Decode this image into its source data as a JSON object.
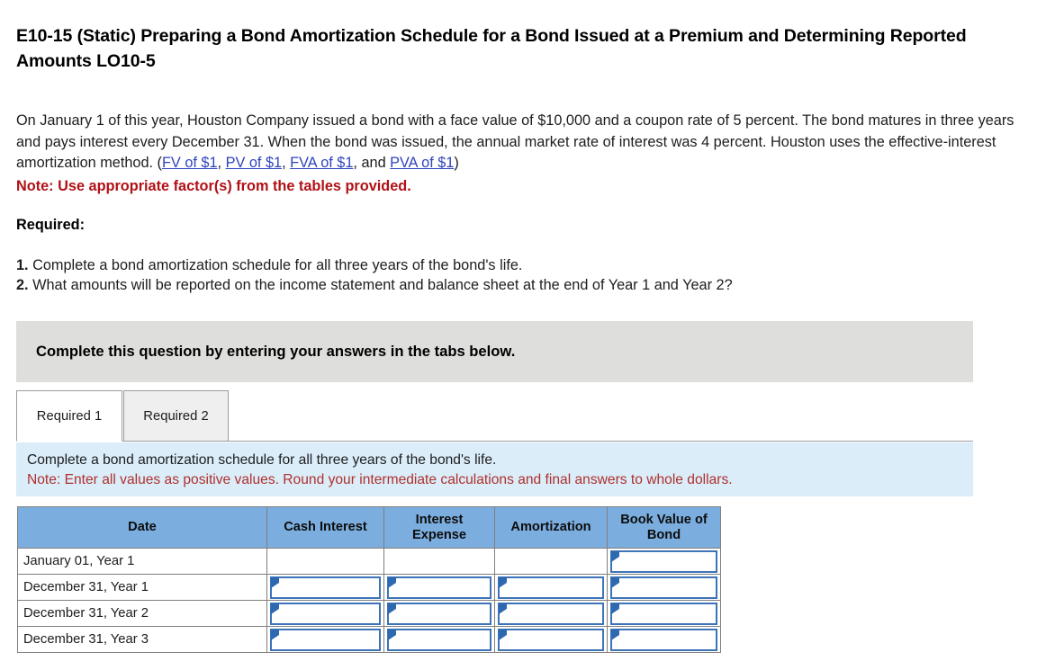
{
  "exercise": {
    "title": "E10-15 (Static) Preparing a Bond Amortization Schedule for a Bond Issued at a Premium and Determining Reported Amounts LO10-5",
    "body_part1": "On January 1 of this year, Houston Company issued a bond with a face value of $10,000 and a coupon rate of 5 percent. The bond matures in three years and pays interest every December 31. When the bond was issued, the annual market rate of interest was 4 percent. Houston uses the effective-interest amortization method. (",
    "links": [
      {
        "label": "FV of $1"
      },
      {
        "label": "PV of $1"
      },
      {
        "label": "FVA of $1"
      },
      {
        "label": "PVA of $1"
      }
    ],
    "link_sep1": ", ",
    "link_sep2": ", ",
    "link_sep3": ", and ",
    "body_part2": ")",
    "note": "Note: Use appropriate factor(s) from the tables provided."
  },
  "required": {
    "heading": "Required:",
    "items": [
      {
        "num": "1.",
        "text": " Complete a bond amortization schedule for all three years of the bond's life."
      },
      {
        "num": "2.",
        "text": " What amounts will be reported on the income statement and balance sheet at the end of Year 1 and Year 2?"
      }
    ]
  },
  "instruction_banner": {
    "text": "Complete this question by entering your answers in the tabs below."
  },
  "tabs": [
    {
      "label": "Required 1",
      "active": true
    },
    {
      "label": "Required 2",
      "active": false
    }
  ],
  "subinstruction": {
    "line1": "Complete a bond amortization schedule for all three years of the bond's life.",
    "note": "Note: Enter all values as positive values. Round your intermediate calculations and final answers to whole dollars."
  },
  "table": {
    "headers": [
      "Date",
      "Cash Interest",
      "Interest Expense",
      "Amortization",
      "Book Value of Bond"
    ],
    "rows": [
      {
        "date": "January 01, Year 1",
        "cash_interest": {
          "type": "empty",
          "value": ""
        },
        "interest_expense": {
          "type": "empty",
          "value": ""
        },
        "amortization": {
          "type": "empty",
          "value": ""
        },
        "book_value": {
          "type": "input",
          "value": ""
        }
      },
      {
        "date": "December 31, Year 1",
        "cash_interest": {
          "type": "input",
          "value": ""
        },
        "interest_expense": {
          "type": "input",
          "value": ""
        },
        "amortization": {
          "type": "input",
          "value": ""
        },
        "book_value": {
          "type": "input",
          "value": ""
        }
      },
      {
        "date": "December 31, Year 2",
        "cash_interest": {
          "type": "input",
          "value": ""
        },
        "interest_expense": {
          "type": "input",
          "value": ""
        },
        "amortization": {
          "type": "input",
          "value": ""
        },
        "book_value": {
          "type": "input",
          "value": ""
        }
      },
      {
        "date": "December 31, Year 3",
        "cash_interest": {
          "type": "input",
          "value": ""
        },
        "interest_expense": {
          "type": "input",
          "value": ""
        },
        "amortization": {
          "type": "input",
          "value": ""
        },
        "book_value": {
          "type": "input",
          "value": ""
        }
      }
    ]
  },
  "colors": {
    "link": "#2f43bd",
    "note_red": "#b01116",
    "subnote_red": "#b0302c",
    "banner_gray": "#dededd",
    "subinstruction_blue": "#daedf9",
    "table_header_blue": "#7badde",
    "input_border_blue": "#3d74b8"
  }
}
